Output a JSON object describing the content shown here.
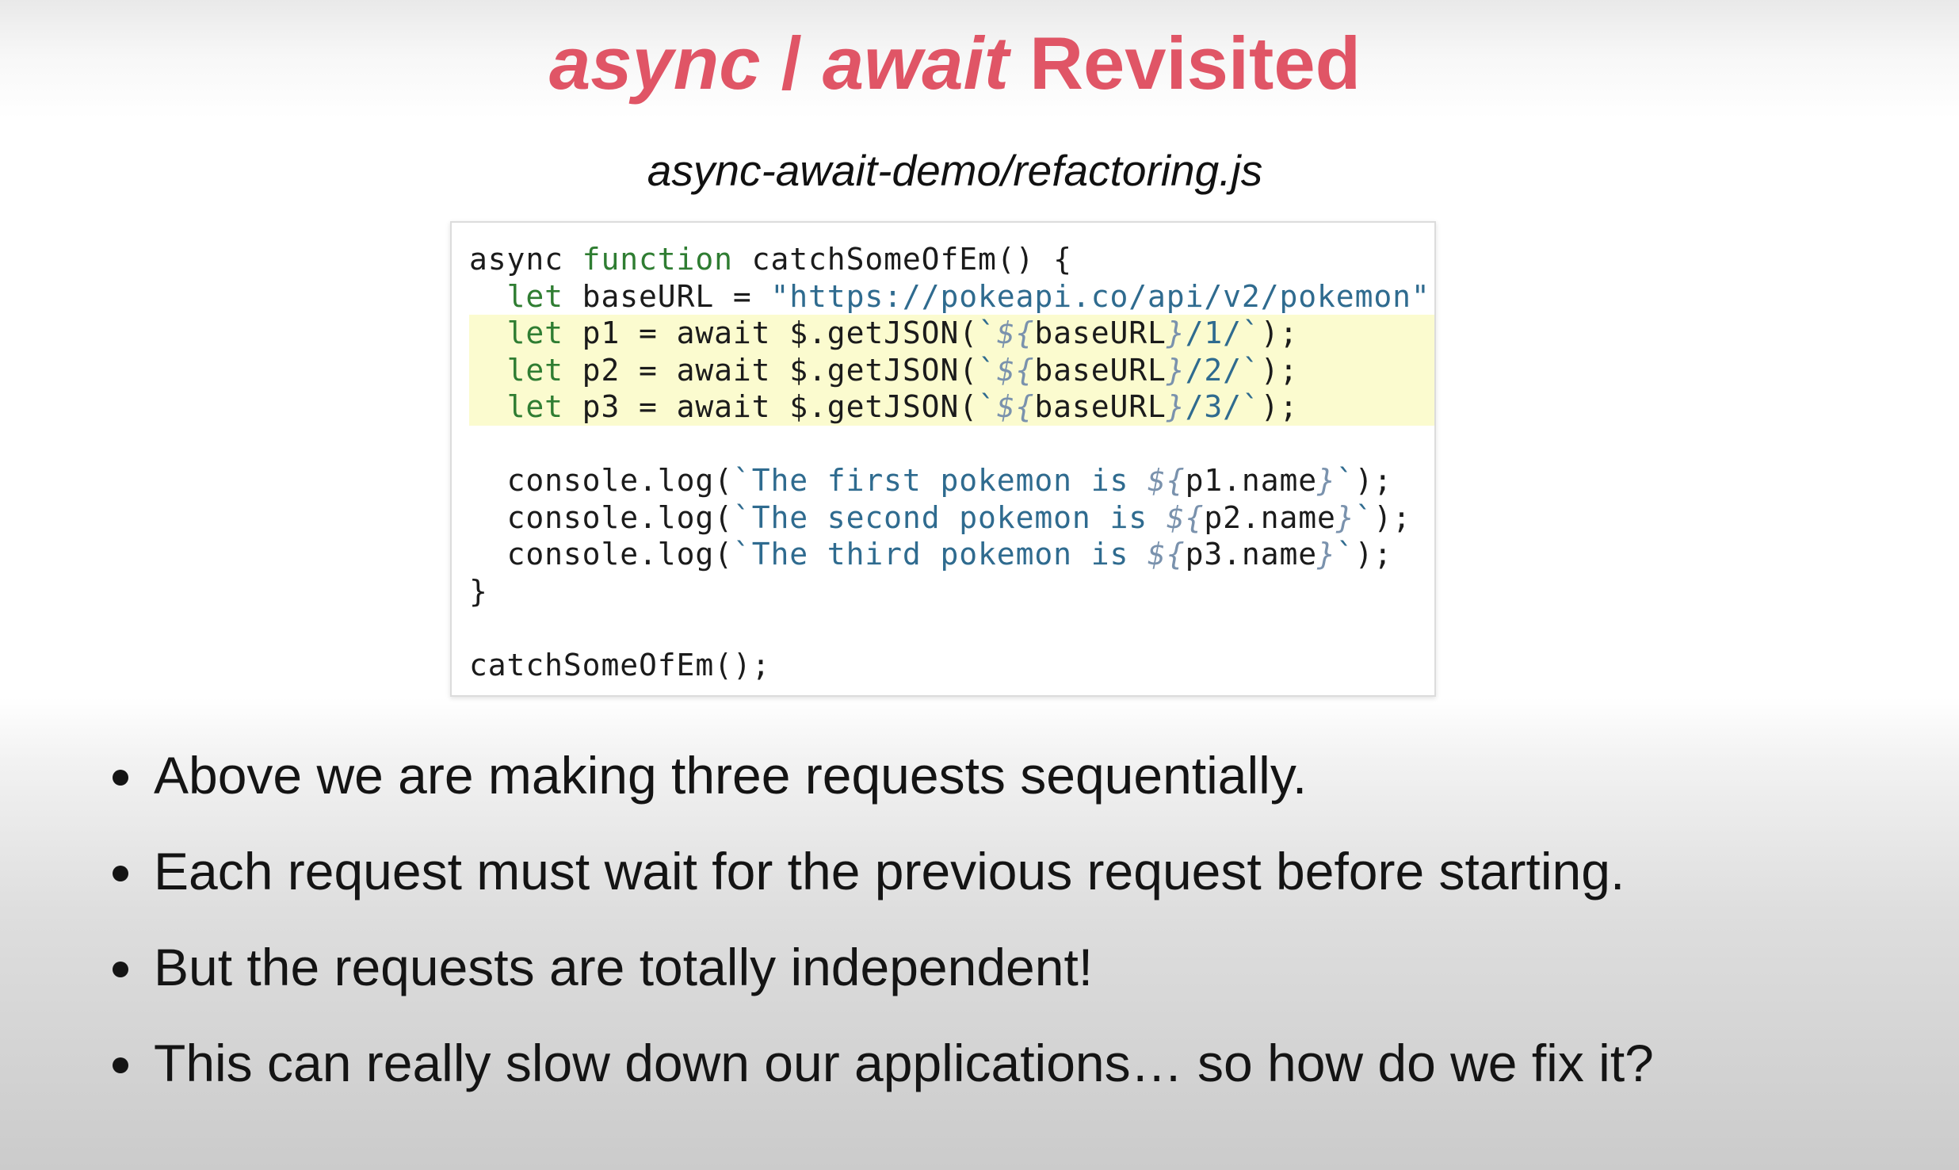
{
  "slide": {
    "title_part1": "async",
    "title_sep": " / ",
    "title_part2": "await",
    "title_part3": " Revisited",
    "filename": "async-await-demo/refactoring.js"
  },
  "code": {
    "async_kw": "async ",
    "function_kw": "function",
    "fn_decl": " catchSomeOfEm() {",
    "indent": "  ",
    "let_kw": "let",
    "baseurl_decl": " baseURL = ",
    "baseurl_value": "\"https://pokeapi.co/api/v2/pokemon\"",
    "semicolon": ";",
    "p1_prefix": " p1 = await $.getJSON(",
    "p2_prefix": " p2 = await $.getJSON(",
    "p3_prefix": " p3 = await $.getJSON(",
    "backtick": "`",
    "tpl_open": "${",
    "tpl_close": "}",
    "baseurl_var": "baseURL",
    "path1": "/1/",
    "path2": "/2/",
    "path3": "/3/",
    "call_close": ");",
    "log_prefix": "console.log(",
    "log1_text": "The first pokemon is ",
    "log2_text": "The second pokemon is ",
    "log3_text": "The third pokemon is ",
    "p1_name": "p1.name",
    "p2_name": "p2.name",
    "p3_name": "p3.name",
    "close_brace": "}",
    "invoke": "catchSomeOfEm();"
  },
  "bullets": [
    "Above we are making three requests sequentially.",
    "Each request must wait for the previous request before starting.",
    "But the requests are totally independent!",
    "This can really slow down our applications… so how do we fix it?"
  ]
}
